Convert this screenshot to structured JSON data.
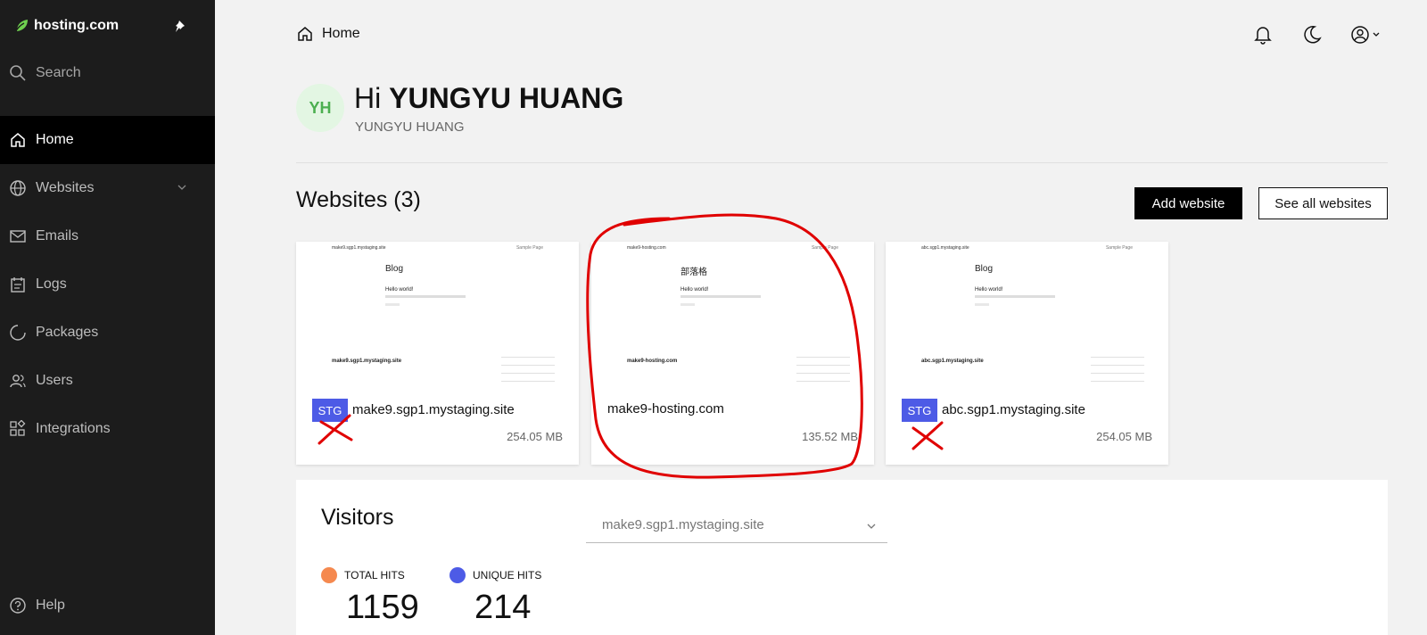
{
  "brand": {
    "name": "hosting.com",
    "accent": "#6fd04f"
  },
  "sidebar": {
    "search_label": "Search",
    "items": [
      {
        "label": "Home",
        "icon": "home-icon",
        "active": true
      },
      {
        "label": "Websites",
        "icon": "globe-icon"
      },
      {
        "label": "Emails",
        "icon": "mail-icon"
      },
      {
        "label": "Logs",
        "icon": "logs-icon"
      },
      {
        "label": "Packages",
        "icon": "package-icon"
      },
      {
        "label": "Users",
        "icon": "users-icon"
      },
      {
        "label": "Integrations",
        "icon": "integrations-icon"
      }
    ],
    "help_label": "Help"
  },
  "header": {
    "breadcrumb": "Home"
  },
  "greeting": {
    "initials": "YH",
    "hi": "Hi",
    "name": "YUNGYU HUANG",
    "subtitle": "YUNGYU HUANG"
  },
  "websites": {
    "title": "Websites (3)",
    "add_label": "Add website",
    "see_all_label": "See all websites",
    "cards": [
      {
        "tag": "STG",
        "name": "make9.sgp1.mystaging.site",
        "size": "254.05 MB",
        "preview": {
          "host": "make9.sgp1.mystaging.site",
          "sample": "Sample Page",
          "heading": "Blog",
          "post": "Hello world!",
          "footer": "make9.sgp1.mystaging.site"
        }
      },
      {
        "tag": "",
        "name": "make9-hosting.com",
        "size": "135.52 MB",
        "preview": {
          "host": "make9-hosting.com",
          "sample": "Sample Page",
          "heading": "部落格",
          "post": "Hello world!",
          "footer": "make9-hosting.com"
        }
      },
      {
        "tag": "STG",
        "name": "abc.sgp1.mystaging.site",
        "size": "254.05 MB",
        "preview": {
          "host": "abc.sgp1.mystaging.site",
          "sample": "Sample Page",
          "heading": "Blog",
          "post": "Hello world!",
          "footer": "abc.sgp1.mystaging.site"
        }
      }
    ]
  },
  "visitors": {
    "title": "Visitors",
    "selected_site": "make9.sgp1.mystaging.site",
    "total_label": "TOTAL HITS",
    "total_value": "1159",
    "total_color": "#f5894f",
    "unique_label": "UNIQUE HITS",
    "unique_value": "214",
    "unique_color": "#4d5be6"
  },
  "colors": {
    "sidebar_bg": "#1c1c1c",
    "stg_badge": "#4d5be6",
    "annotation": "#e00000"
  }
}
